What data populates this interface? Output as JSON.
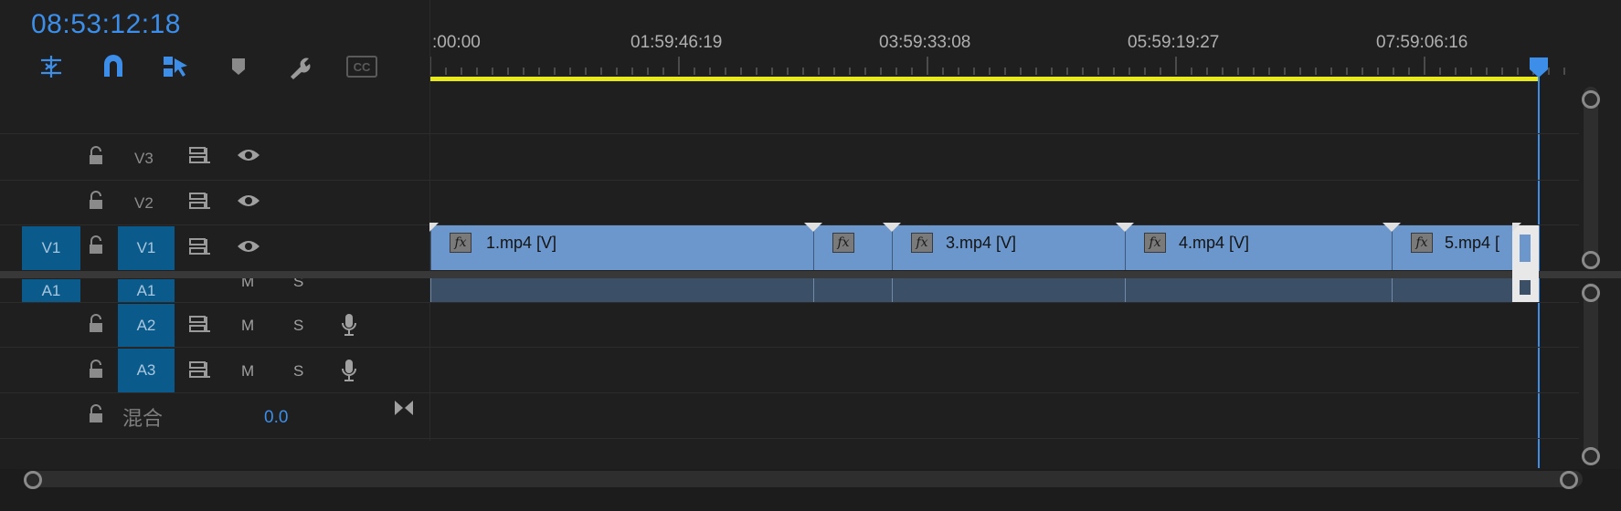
{
  "timecode": "08:53:12:18",
  "toolbar": {
    "tools": [
      {
        "name": "nest-icon",
        "active": true
      },
      {
        "name": "snap-magnet-icon",
        "active": true
      },
      {
        "name": "linked-selection-icon",
        "active": true
      },
      {
        "name": "add-marker-icon",
        "active": false
      },
      {
        "name": "wrench-icon",
        "active": false
      },
      {
        "name": "captions-icon",
        "label": "CC",
        "active": false
      }
    ]
  },
  "ruler": {
    "labels": [
      ":00:00",
      "01:59:46:19",
      "03:59:33:08",
      "05:59:19:27",
      "07:59:06:16"
    ]
  },
  "tracks": {
    "video": [
      {
        "target": "",
        "name": "V3"
      },
      {
        "target": "",
        "name": "V2"
      },
      {
        "target": "V1",
        "name": "V1"
      }
    ],
    "audio": [
      {
        "target": "A1",
        "name": "A1",
        "m": "M",
        "s": "S"
      },
      {
        "target": "",
        "name": "A2",
        "m": "M",
        "s": "S"
      },
      {
        "target": "",
        "name": "A3",
        "m": "M",
        "s": "S"
      }
    ],
    "mix": {
      "label": "混合",
      "value": "0.0"
    }
  },
  "clips": [
    {
      "name": "1.mp4 [V]",
      "fx": "fx"
    },
    {
      "name": "",
      "fx": "fx"
    },
    {
      "name": "3.mp4 [V]",
      "fx": "fx"
    },
    {
      "name": "4.mp4 [V]",
      "fx": "fx"
    },
    {
      "name": "5.mp4 [",
      "fx": "fx"
    }
  ],
  "colors": {
    "accent": "#3d8ee8",
    "work_area_bar": "#e8e81e",
    "track_target": "#0a5a8c",
    "video_clip": "#6b97cc",
    "audio_clip": "#3b5067"
  }
}
